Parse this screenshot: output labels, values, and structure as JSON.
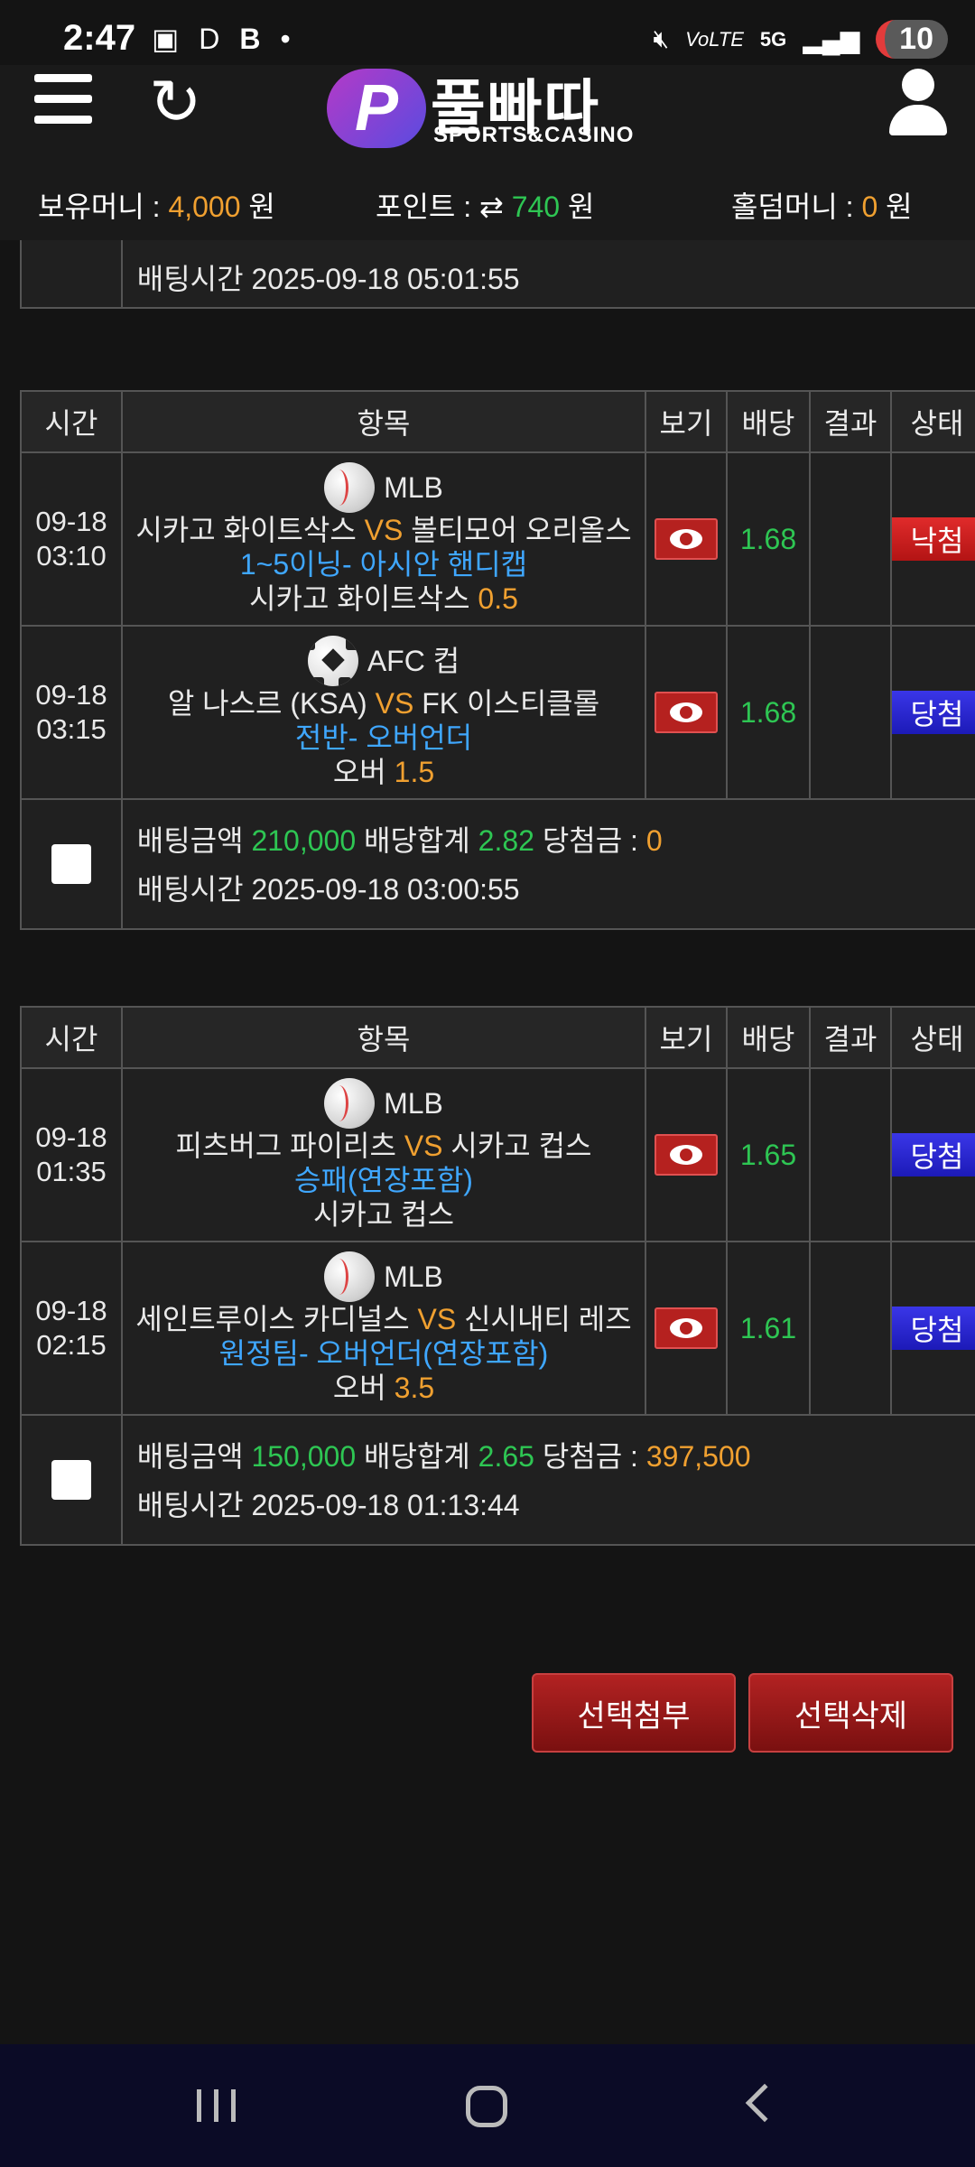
{
  "status_bar": {
    "time": "2:47",
    "left_icons": [
      "screenshot-icon",
      "D",
      "B",
      "•"
    ],
    "right_icons": [
      "mute-icon",
      "volte-icon",
      "5g-icon",
      "signal-icon"
    ],
    "battery": "10"
  },
  "header": {
    "logo_text": "풀빠따",
    "logo_sub": "SPORTS&CASINO",
    "logo_letter": "P"
  },
  "balance": {
    "money_label": "보유머니 :",
    "money_value": "4,000",
    "money_unit": "원",
    "point_label": "포인트 :",
    "point_icon": "⇄",
    "point_value": "740",
    "point_unit": "원",
    "holdem_label": "홀덤머니 :",
    "holdem_value": "0",
    "holdem_unit": "원"
  },
  "table_headers": {
    "time": "시간",
    "item": "항목",
    "view": "보기",
    "odds": "배당",
    "result": "결과",
    "status": "상태"
  },
  "summary_labels": {
    "amount": "배팅금액",
    "odds_total": "배당합계",
    "winnings": "당첨금 :",
    "bet_time": "배팅시간"
  },
  "partial_bet": {
    "bet_time": "2025-09-18 05:01:55"
  },
  "bets": [
    {
      "games": [
        {
          "date": "09-18",
          "time": "03:10",
          "sport_icon": "baseball-icon",
          "league": "MLB",
          "home": "시카고 화이트삭스",
          "vs": "VS",
          "away": "볼티모어 오리올스",
          "market": "1~5이닝- 아시안 핸디캡",
          "pick": "시카고 화이트삭스",
          "pick_line": "0.5",
          "odds": "1.68",
          "result": "",
          "status": "낙첨",
          "status_type": "lose"
        },
        {
          "date": "09-18",
          "time": "03:15",
          "sport_icon": "soccer-ball-icon",
          "league": "AFC 컵",
          "home": "알 나스르 (KSA)",
          "vs": "VS",
          "away": "FK 이스티클롤",
          "market": "전반- 오버언더",
          "pick": "오버",
          "pick_line": "1.5",
          "odds": "1.68",
          "result": "",
          "status": "당첨",
          "status_type": "win"
        }
      ],
      "amount": "210,000",
      "odds_total": "2.82",
      "winnings": "0",
      "bet_time": "2025-09-18 03:00:55"
    },
    {
      "games": [
        {
          "date": "09-18",
          "time": "01:35",
          "sport_icon": "baseball-icon",
          "league": "MLB",
          "home": "피츠버그 파이리츠",
          "vs": "VS",
          "away": "시카고 컵스",
          "market": "승패(연장포함)",
          "pick": "시카고 컵스",
          "pick_line": "",
          "odds": "1.65",
          "result": "",
          "status": "당첨",
          "status_type": "win"
        },
        {
          "date": "09-18",
          "time": "02:15",
          "sport_icon": "baseball-icon",
          "league": "MLB",
          "home": "세인트루이스 카디널스",
          "vs": "VS",
          "away": "신시내티 레즈",
          "market": "원정팀- 오버언더(연장포함)",
          "pick": "오버",
          "pick_line": "3.5",
          "odds": "1.61",
          "result": "",
          "status": "당첨",
          "status_type": "win"
        }
      ],
      "amount": "150,000",
      "odds_total": "2.65",
      "winnings": "397,500",
      "bet_time": "2025-09-18 01:13:44"
    }
  ],
  "actions": {
    "attach": "선택첨부",
    "delete": "선택삭제"
  },
  "colors": {
    "accent_orange": "#f0a030",
    "accent_green": "#2ec653",
    "accent_blue": "#3fa7ff",
    "lose_red": "#c81e1e",
    "win_blue": "#2a28d8"
  }
}
